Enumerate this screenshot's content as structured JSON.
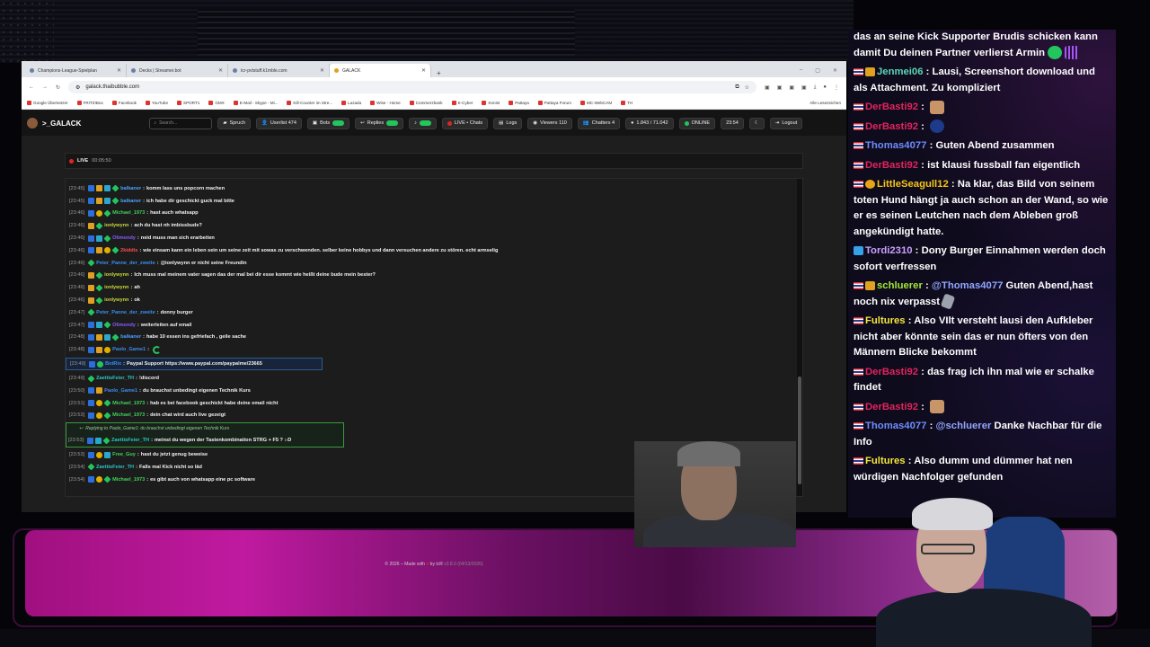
{
  "browser": {
    "tabs": [
      {
        "label": "Champions-League-Spielplan"
      },
      {
        "label": "Decks | Streamer.bot"
      },
      {
        "label": "tcr-pvtstuff.k1mble.com"
      },
      {
        "label": "GALACK",
        "active": true
      }
    ],
    "url": "galack.thaibubble.com",
    "bookmarks": [
      "Google Übersetzer",
      "FRITZ!Box",
      "Facebook",
      "YouTube",
      "SPORT1",
      "GMX",
      "E-Mail - Skype - Mi...",
      "Kill-Counter im Stre...",
      "Lazada",
      "Wise - Home",
      "Commerzbank",
      "K-Cyber",
      "Konist",
      "Pattaya",
      "Pattaya Forum",
      "MC-WebCAM",
      "TH"
    ],
    "bookmarks_other": "Alle Lesezeichen"
  },
  "app": {
    "brand": ">_GALACK",
    "search_placeholder": "Search...",
    "nav": {
      "spruch": "Spruch",
      "userlist": "Userlist 474",
      "bots": "Bots",
      "replies": "Replies",
      "live_chats": "LIVE • Chats",
      "logs": "Logs",
      "viewers": "Viewers 110",
      "chatters": "Chatters 4",
      "messages": "1.843 / 71.042",
      "online": "ONLINE",
      "time": "23:54",
      "logout": "Logout"
    },
    "live": {
      "label": "LIVE",
      "duration": "00:05:50"
    },
    "footer": {
      "prefix": "© 2026 – Made with",
      "suffix": "by tcR",
      "version": "v3.8.0 (04/13/2026)"
    }
  },
  "chat": [
    {
      "ts": "[23:45]",
      "badges": [
        "mod",
        "sub",
        "gift",
        "spark"
      ],
      "name": "balkaner",
      "color": "#4aa3ff",
      "msg": "komm lass uns popcorn machen"
    },
    {
      "ts": "[23:45]",
      "badges": [
        "mod",
        "sub",
        "gift",
        "spark"
      ],
      "name": "balkaner",
      "color": "#4aa3ff",
      "msg": "ich habe dir geschickt guck mal bitte"
    },
    {
      "ts": "[23:46]",
      "badges": [
        "mod",
        "tier",
        "spark"
      ],
      "name": "Michael_1973",
      "color": "#3fd35a",
      "msg": "hast auch whatsapp"
    },
    {
      "ts": "[23:46]",
      "badges": [
        "sub",
        "spark"
      ],
      "name": "ionlywynn",
      "color": "#c8d83a",
      "msg": "ach du hast nh imbissbude?"
    },
    {
      "ts": "[23:46]",
      "badges": [
        "mod",
        "gift",
        "spark"
      ],
      "name": "Olimondy",
      "color": "#8a5cff",
      "msg": "neid muss man sich erarbeiten"
    },
    {
      "ts": "[23:46]",
      "badges": [
        "mod",
        "sub",
        "tier",
        "spark"
      ],
      "name": "2kiddis",
      "color": "#ff4d4d",
      "msg": "wie einsam kann ein leben sein um seine zeit mit sowas zu verschwenden. selber keine hobbys und dann versuchen andere zu stören. echt armselig"
    },
    {
      "ts": "[23:46]",
      "badges": [
        "spark"
      ],
      "name": "Peter_Panne_der_zweite",
      "color": "#3a8ef0",
      "msg": "@ionlywynn er nicht seine Freundin"
    },
    {
      "ts": "[23:46]",
      "badges": [
        "sub",
        "spark"
      ],
      "name": "ionlywynn",
      "color": "#c8d83a",
      "msg": "Ich muss mal meinem vater sagen das der mal bei dir esse kommt wie heißt deine bude mein bester?"
    },
    {
      "ts": "[23:46]",
      "badges": [
        "sub",
        "spark"
      ],
      "name": "ionlywynn",
      "color": "#c8d83a",
      "msg": "ah"
    },
    {
      "ts": "[23:46]",
      "badges": [
        "sub",
        "spark"
      ],
      "name": "ionlywynn",
      "color": "#c8d83a",
      "msg": "ok"
    },
    {
      "ts": "[23:47]",
      "badges": [
        "spark"
      ],
      "name": "Peter_Panne_der_zweite",
      "color": "#3a8ef0",
      "msg": "donny burger"
    },
    {
      "ts": "[23:47]",
      "badges": [
        "mod",
        "gift",
        "spark"
      ],
      "name": "Olimondy",
      "color": "#8a5cff",
      "msg": "weiterleiten auf email"
    },
    {
      "ts": "[23:48]",
      "badges": [
        "mod",
        "sub",
        "gift",
        "spark"
      ],
      "name": "balkaner",
      "color": "#4aa3ff",
      "msg": "habe 10 essen ins gefriefach , geile sache"
    },
    {
      "ts": "[23:48]",
      "badges": [
        "mod",
        "sub",
        "tier"
      ],
      "name": "Paolo_Game1",
      "color": "#3a8ef0",
      "msg": "",
      "emote": true
    },
    {
      "ts": "[23:49]",
      "badges": [
        "mod",
        "bot"
      ],
      "name": "BotRix",
      "color": "#3a8ef0",
      "msg": "Paypal Support https://www.paypal.com/paypalme/23665",
      "bot": true
    },
    {
      "ts": "[23:49]",
      "badges": [
        "spark"
      ],
      "name": "ZaettisFeier_TH",
      "color": "#2cc6c6",
      "msg": "!discord"
    },
    {
      "ts": "[23:50]",
      "badges": [
        "mod",
        "sub"
      ],
      "name": "Paolo_Game1",
      "color": "#3a8ef0",
      "msg": "du brauchst unbedingt eigenen Technik Kurs"
    },
    {
      "ts": "[23:51]",
      "badges": [
        "mod",
        "tier",
        "spark"
      ],
      "name": "Michael_1973",
      "color": "#3fd35a",
      "msg": "hab es bei facebook geschickt habe deine email nicht"
    },
    {
      "ts": "[23:53]",
      "badges": [
        "mod",
        "tier",
        "spark"
      ],
      "name": "Michael_1973",
      "color": "#3fd35a",
      "msg": "dein chat wird auch live gezeigt"
    },
    {
      "reply_to": "Replying to Paolo_Game1: du brauchst unbedingt eigenen Technik Kurs",
      "ts": "[23:53]",
      "badges": [
        "mod",
        "gift",
        "spark"
      ],
      "name": "ZaettisFeier_TH",
      "color": "#2cc6c6",
      "msg": "meinst du wegen der Tastenkombination STRG + F5 ? :-D"
    },
    {
      "ts": "[23:53]",
      "badges": [
        "mod",
        "tier",
        "gift"
      ],
      "name": "Free_Guy",
      "color": "#3fd35a",
      "msg": "hast du jetzt genug beweise"
    },
    {
      "ts": "[23:54]",
      "badges": [
        "spark"
      ],
      "name": "ZaettisFeier_TH",
      "color": "#2cc6c6",
      "msg": "Falls mal Kick nicht so läd"
    },
    {
      "ts": "[23:54]",
      "badges": [
        "mod",
        "tier",
        "spark"
      ],
      "name": "Michael_1973",
      "color": "#3fd35a",
      "msg": "es gibt auch von whatsapp eine pc software"
    }
  ],
  "overlay": [
    {
      "badges": [],
      "name": "",
      "color": "#ffffff",
      "msg": "das an seine Kick Supporter Brudis schicken kann damit Du deinen Partner verlierst Armin",
      "emotes": [
        "green",
        "purple"
      ]
    },
    {
      "badges": [
        "flag",
        "sub"
      ],
      "name": "Jenmei06",
      "color": "#5bd6b8",
      "msg": "Lausi, Screenshort download und als Attachment. Zu kompliziert"
    },
    {
      "badges": [
        "flag"
      ],
      "name": "DerBasti92",
      "color": "#e0245e",
      "msg": "",
      "emotes": [
        "tan"
      ]
    },
    {
      "badges": [
        "flag"
      ],
      "name": "DerBasti92",
      "color": "#e0245e",
      "msg": "",
      "emotes": [
        "skull"
      ]
    },
    {
      "badges": [
        "flag"
      ],
      "name": "Thomas4077",
      "color": "#6f8cff",
      "msg": "Guten Abend zusammen"
    },
    {
      "badges": [
        "flag"
      ],
      "name": "DerBasti92",
      "color": "#e0245e",
      "msg": "ist klausi fussball fan eigentlich"
    },
    {
      "badges": [
        "flag",
        "gold"
      ],
      "name": "LittleSeagull12",
      "color": "#f5c518",
      "msg": "Na klar, das Bild von seinem toten Hund hängt ja auch schon an der Wand, so wie er es seinen Leutchen nach dem Ableben groß angekündigt hatte."
    },
    {
      "badges": [
        "blue"
      ],
      "name": "Tordi2310",
      "color": "#c8a2ff",
      "msg": "Dony Burger Einnahmen werden doch sofort verfressen"
    },
    {
      "badges": [
        "flag",
        "sub"
      ],
      "name": "schluerer",
      "color": "#a3e635",
      "msg": "@Thomas4077 Guten Abend,hast noch nix verpasst",
      "mention": "@Thomas4077",
      "emotes": [
        "hand"
      ]
    },
    {
      "badges": [
        "flag"
      ],
      "name": "Fultures",
      "color": "#f5e63b",
      "msg": "Also VIlt versteht lausi den Aufkleber nicht aber könnte sein das er nun öfters von den Männern Blicke bekommt"
    },
    {
      "badges": [
        "flag"
      ],
      "name": "DerBasti92",
      "color": "#e0245e",
      "msg": "das frag ich ihn mal wie er schalke findet"
    },
    {
      "badges": [
        "flag"
      ],
      "name": "DerBasti92",
      "color": "#e0245e",
      "msg": "",
      "emotes": [
        "tan"
      ]
    },
    {
      "badges": [
        "flag"
      ],
      "name": "Thomas4077",
      "color": "#6f8cff",
      "msg": "@schluerer Danke Nachbar für die Info",
      "mention": "@schluerer"
    },
    {
      "badges": [
        "flag"
      ],
      "name": "Fultures",
      "color": "#f5e63b",
      "msg": "Also dumm und dümmer hat nen würdigen Nachfolger gefunden"
    }
  ]
}
